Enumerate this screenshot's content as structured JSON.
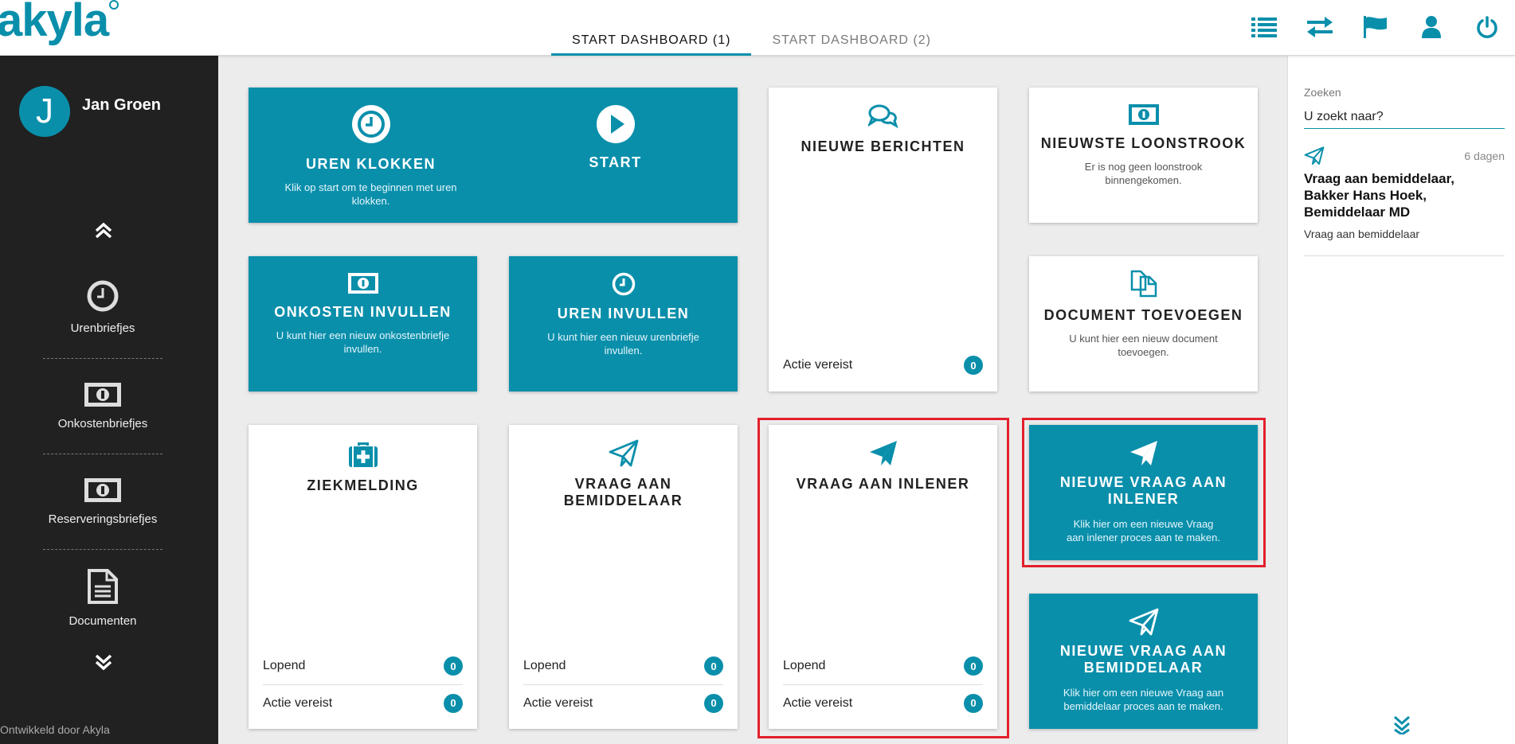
{
  "brand": {
    "logo_text": "akyla",
    "accent": "#0a8fab"
  },
  "tabs": [
    {
      "label": "START DASHBOARD (1)",
      "active": true
    },
    {
      "label": "START DASHBOARD (2)",
      "active": false
    }
  ],
  "top_icons": [
    "list-icon",
    "swap-icon",
    "flag-icon",
    "user-icon",
    "power-icon"
  ],
  "user": {
    "initial": "J",
    "name": "Jan Groen"
  },
  "sidebar": {
    "items": [
      {
        "label": "Urenbriefjes",
        "icon": "clock-icon"
      },
      {
        "label": "Onkostenbriefjes",
        "icon": "banknote-icon"
      },
      {
        "label": "Reserveringsbriefjes",
        "icon": "banknote-icon"
      },
      {
        "label": "Documenten",
        "icon": "document-icon"
      }
    ],
    "footer": "Ontwikkeld door Akyla"
  },
  "tiles": {
    "uren_klokken": {
      "title": "UREN KLOKKEN",
      "desc": "Klik op start om te beginnen met uren klokken.",
      "start_label": "START"
    },
    "nieuwe_berichten": {
      "title": "NIEUWE BERICHTEN",
      "actie_label": "Actie vereist",
      "actie_count": "0"
    },
    "loonstrook": {
      "title": "NIEUWSTE LOONSTROOK",
      "desc": "Er is nog geen loonstrook binnengekomen."
    },
    "onkosten": {
      "title": "ONKOSTEN INVULLEN",
      "desc": "U kunt hier een nieuw onkostenbriefje invullen."
    },
    "uren_invullen": {
      "title": "UREN INVULLEN",
      "desc": "U kunt hier een nieuw urenbriefje invullen."
    },
    "document": {
      "title": "DOCUMENT TOEVOEGEN",
      "desc": "U kunt hier een nieuw document toevoegen."
    },
    "ziekmelding": {
      "title": "ZIEKMELDING",
      "lopend_label": "Lopend",
      "lopend_count": "0",
      "actie_label": "Actie vereist",
      "actie_count": "0"
    },
    "vraag_bemiddelaar": {
      "title": "VRAAG AAN BEMIDDELAAR",
      "lopend_label": "Lopend",
      "lopend_count": "0",
      "actie_label": "Actie vereist",
      "actie_count": "0"
    },
    "vraag_inlener": {
      "title": "VRAAG AAN INLENER",
      "lopend_label": "Lopend",
      "lopend_count": "0",
      "actie_label": "Actie vereist",
      "actie_count": "0"
    },
    "nieuwe_vraag_inlener": {
      "title": "NIEUWE VRAAG AAN INLENER",
      "desc": "Klik hier om een nieuwe Vraag aan inlener proces aan te maken."
    },
    "nieuwe_vraag_bemiddelaar": {
      "title": "NIEUWE VRAAG AAN BEMIDDELAAR",
      "desc": "Klik hier om een nieuwe Vraag aan bemiddelaar proces aan te maken."
    }
  },
  "search": {
    "label": "Zoeken",
    "placeholder": "U zoekt naar?"
  },
  "messages": [
    {
      "time": "6 dagen",
      "title": "Vraag aan bemiddelaar, Bakker Hans Hoek, Bemiddelaar MD",
      "subtitle": "Vraag aan bemiddelaar"
    }
  ],
  "colors": {
    "teal": "#0a8fab",
    "sidebar": "#212121",
    "highlight": "#e3202b"
  }
}
